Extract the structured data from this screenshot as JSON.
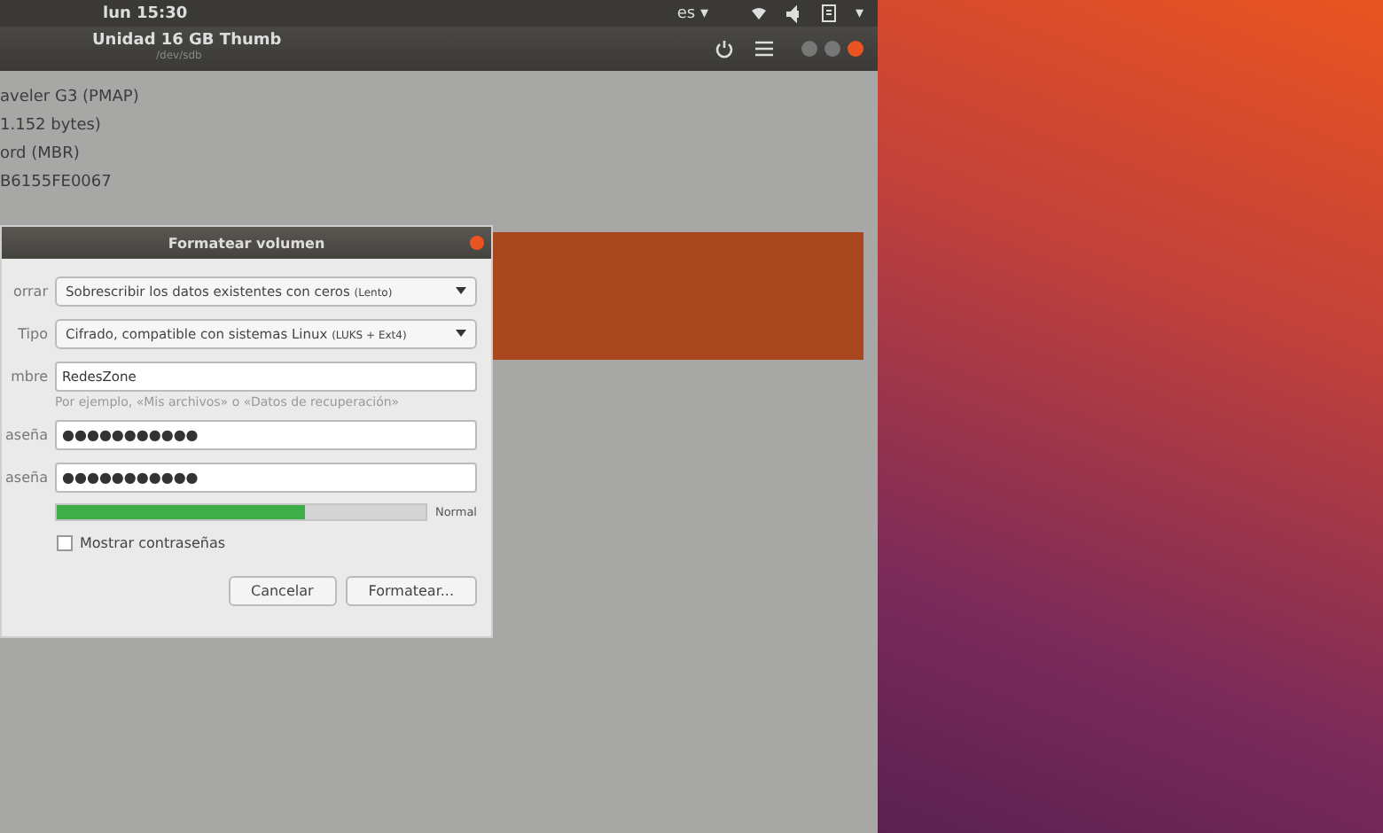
{
  "top_bar": {
    "clock": "lun 15:30",
    "language": "es ▾",
    "menu_caret": "▾"
  },
  "window": {
    "title": "Unidad 16 GB Thumb",
    "subtitle": "/dev/sdb"
  },
  "details": [
    "aveler G3 (PMAP)",
    "1.152 bytes)",
    "ord (MBR)",
    "B6155FE0067"
  ],
  "dialog": {
    "title": "Formatear volumen",
    "fields": [
      {
        "kind": "dropdown",
        "label": "orrar",
        "value": "Sobrescribir los datos existentes con ceros",
        "note": "(Lento)"
      },
      {
        "kind": "dropdown",
        "label": "Tipo",
        "value": "Cifrado, compatible con sistemas Linux",
        "note": "(LUKS + Ext4)"
      },
      {
        "kind": "text",
        "label": "mbre",
        "value": "RedesZone",
        "hint": "Por ejemplo, «Mis archivos» o «Datos de recuperación»"
      },
      {
        "kind": "password",
        "label": "aseña",
        "value": "●●●●●●●●●●●"
      },
      {
        "kind": "password",
        "label": "aseña",
        "value": "●●●●●●●●●●●"
      },
      {
        "kind": "strength",
        "level": 0.67,
        "reading": "Normal"
      },
      {
        "kind": "checkbox",
        "label": "Mostrar contraseñas",
        "checked": false
      }
    ],
    "buttons": [
      "Cancelar",
      "Formatear..."
    ]
  }
}
